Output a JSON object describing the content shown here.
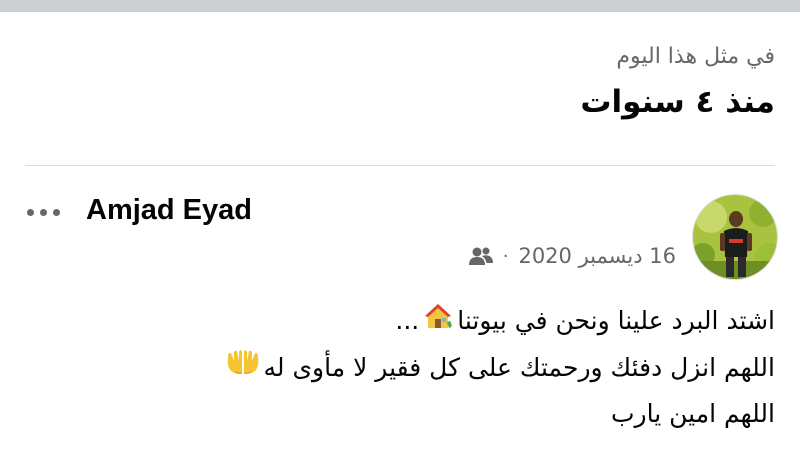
{
  "memory": {
    "label": "في مثل هذا اليوم",
    "title": "منذ ٤ سنوات"
  },
  "post": {
    "author": "Amjad Eyad",
    "date": "16 ديسمبر 2020",
    "separator": "·",
    "audience_icon": "friends-icon",
    "more_icon": "more-options-icon",
    "lines": [
      "اشتد البرد علينا ونحن في بيوتنا",
      "اللهم انزل دفئك ورحمتك على كل فقير لا مأوى له",
      "اللهم امين يارب"
    ],
    "line1_suffix": "...",
    "emoji": [
      "house-emoji",
      "palms-up-together-emoji"
    ]
  },
  "colors": {
    "top_strip": "#ccd0d5",
    "secondary_text": "#65676b",
    "primary_text": "#050505",
    "divider": "#dadde1"
  }
}
